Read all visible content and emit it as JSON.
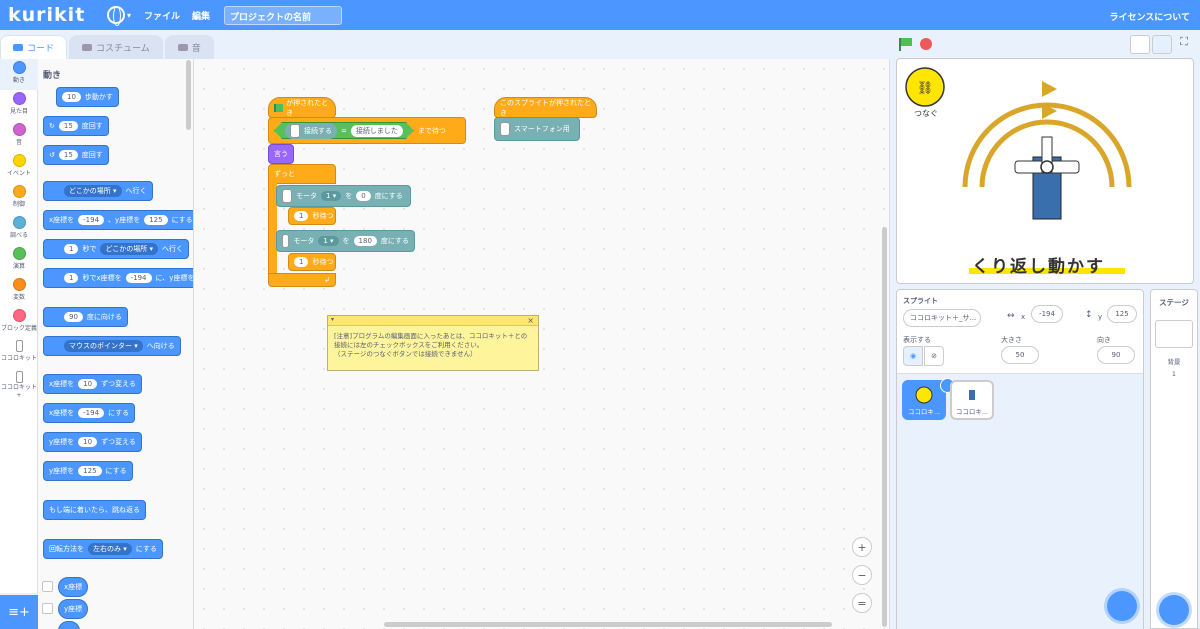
{
  "app": {
    "logo": "kurikit",
    "menu": [
      "ファイル",
      "編集"
    ],
    "project_title": "プロジェクトの名前",
    "license_link": "ライセンスについて"
  },
  "tabs": [
    {
      "label": "コード"
    },
    {
      "label": "コスチューム"
    },
    {
      "label": "音"
    }
  ],
  "categories": [
    {
      "label": "動き",
      "color": "#4c97ff"
    },
    {
      "label": "見た目",
      "color": "#9966ff"
    },
    {
      "label": "音",
      "color": "#cf63cf"
    },
    {
      "label": "イベント",
      "color": "#ffd500"
    },
    {
      "label": "制御",
      "color": "#ffab19"
    },
    {
      "label": "調べる",
      "color": "#5cb1d6"
    },
    {
      "label": "演算",
      "color": "#59c059"
    },
    {
      "label": "変数",
      "color": "#ff8c1a"
    },
    {
      "label": "ブロック定義",
      "color": "#ff6680"
    },
    {
      "label": "ココロキット"
    },
    {
      "label": "ココロキット+"
    }
  ],
  "palette": {
    "title": "動き",
    "move_steps": {
      "value": "10",
      "label": "歩動かす"
    },
    "turn_right": {
      "value": "15",
      "label": "度回す"
    },
    "turn_left": {
      "value": "15",
      "label": "度回す"
    },
    "goto": {
      "dropdown": "どこかの場所",
      "label": "へ行く"
    },
    "goto_xy": {
      "x_label": "x座標を",
      "x": "-194",
      "y_label": "、y座標を",
      "y": "125",
      "suffix": "にする"
    },
    "glide": {
      "secs": "1",
      "label1": "秒で",
      "dropdown": "どこかの場所",
      "label2": "へ行く"
    },
    "glide_xy": {
      "secs": "1",
      "label1": "秒でx座標を",
      "x": "-194",
      "label2": "に、y座標を"
    },
    "point_dir": {
      "value": "90",
      "label": "度に向ける"
    },
    "point_towards": {
      "dropdown": "マウスのポインター",
      "label": "へ向ける"
    },
    "change_x": {
      "label1": "x座標を",
      "value": "10",
      "label2": "ずつ変える"
    },
    "set_x": {
      "label1": "x座標を",
      "value": "-194",
      "label2": "にする"
    },
    "change_y": {
      "label1": "y座標を",
      "value": "10",
      "label2": "ずつ変える"
    },
    "set_y": {
      "label1": "y座標を",
      "value": "125",
      "label2": "にする"
    },
    "bounce": "もし端に着いたら、跳ね返る",
    "rotation_style": {
      "label1": "回転方法を",
      "dropdown": "左右のみ",
      "label2": "にする"
    },
    "x_position": "x座標",
    "y_position": "y座標"
  },
  "script1": {
    "hat": "が押されたとき",
    "wait_until": "まで待つ",
    "connect_label": "接続する",
    "equals": "=",
    "connected": "接続しました",
    "say": "言う",
    "forever": "ずっと",
    "motor1": {
      "label": "モータ",
      "num": "1",
      "wo": "を",
      "deg": "0",
      "suffix": "度にする"
    },
    "wait1": {
      "secs": "1",
      "label": "秒待つ"
    },
    "motor2": {
      "label": "モータ",
      "num": "1",
      "wo": "を",
      "deg": "180",
      "suffix": "度にする"
    },
    "wait2": {
      "secs": "1",
      "label": "秒待つ"
    }
  },
  "script2": {
    "hat": "このスプライトが押されたとき",
    "block": "スマートフォン用"
  },
  "note": {
    "line1": "[注意]プログラムの編集画面に入ったあとは、ココロキット＋との",
    "line2": "接続には左のチェックボックスをご利用ください。",
    "line3": "（ステージのつなぐボタンでは接続できません）"
  },
  "zoom": [
    "+",
    "−",
    "="
  ],
  "stage": {
    "connect_label": "つなぐ",
    "caption": "くり返し動かす"
  },
  "sprite_info": {
    "section_label": "スプライト",
    "name": "ココロキット＋_サ...",
    "x_label": "x",
    "x": "-194",
    "y_label": "y",
    "y": "125",
    "show_label": "表示する",
    "size_label": "大きさ",
    "size": "50",
    "direction_label": "向き",
    "direction": "90"
  },
  "sprites": [
    {
      "name": "ココロキ..."
    },
    {
      "name": "ココロキ..."
    }
  ],
  "stage_pane": {
    "title": "ステージ",
    "backdrops_label": "背景",
    "backdrops_count": "1"
  }
}
